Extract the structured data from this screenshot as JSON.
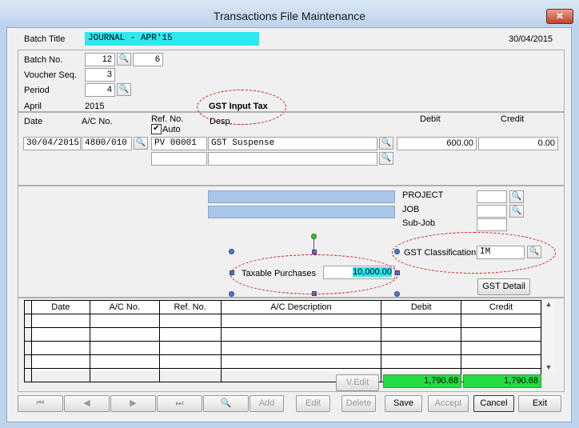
{
  "window": {
    "title": "Transactions File Maintenance",
    "close_glyph": "✕"
  },
  "header": {
    "batch_title_label": "Batch Title",
    "batch_title_value": "JOURNAL - APR'15",
    "date": "30/04/2015",
    "batch_no_label": "Batch No.",
    "batch_no_value": "12",
    "batch_no_second": "6",
    "voucher_seq_label": "Voucher Seq.",
    "voucher_seq_value": "3",
    "period_label": "Period",
    "period_value": "4",
    "month": "April",
    "year": "2015",
    "gst_note": "GST Input Tax"
  },
  "entry": {
    "date_label": "Date",
    "ac_label": "A/C No.",
    "ref_label": "Ref. No.",
    "auto_label": "Auto",
    "auto_checked": true,
    "desp_label": "Desp.",
    "debit_label": "Debit",
    "credit_label": "Credit",
    "date_value": "30/04/2015",
    "ac_value": "4800/010",
    "ref_value": "PV 00001",
    "desp_value": "GST Suspense",
    "debit_value": "600.00",
    "credit_value": "0.00"
  },
  "details": {
    "project_label": "PROJECT",
    "job_label": "JOB",
    "subjob_label": "Sub-Job",
    "gst_class_label": "GST Classification",
    "gst_class_value": "IM",
    "gst_detail_button": "GST Detail",
    "taxable_label": "Taxable Purchases",
    "taxable_value": "10,000.00"
  },
  "grid": {
    "columns": [
      "Date",
      "A/C No.",
      "Ref. No.",
      "A/C Description",
      "Debit",
      "Credit"
    ],
    "rows": 5
  },
  "totals": {
    "vedit_label": "V.Edit",
    "total_debit": "1,790.68",
    "total_credit": "1,790.68",
    "total_color": "#22dd44"
  },
  "toolbar": {
    "first": "⏮",
    "prev": "◀",
    "next": "▶",
    "last": "⏭",
    "find": "🔍",
    "add": "Add",
    "edit": "Edit",
    "delete": "Delete",
    "save": "Save",
    "accept": "Accept",
    "cancel": "Cancel",
    "exit": "Exit"
  },
  "colors": {
    "highlight_cyan": "#2ee8f0",
    "field_blue": "#a9c6e8",
    "annotation_red": "#d21a1a"
  }
}
